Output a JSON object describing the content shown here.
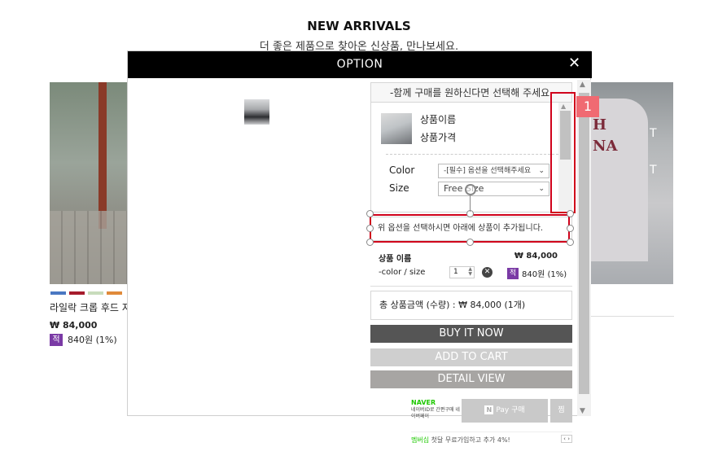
{
  "header": {
    "title": "NEW ARRIVALS",
    "subtitle": "더 좋은 제품으로 찾아온 신상품, 만나보세요."
  },
  "background_product": {
    "name": "라일락 크롭 후드 지",
    "price": "₩ 84,000",
    "mileage_badge": "적",
    "mileage": "840원 (1%)",
    "swatch_colors": [
      "#4a78c2",
      "#a61c2c",
      "#c8dcbc",
      "#e08a3a"
    ],
    "right_print": "H\nNA",
    "right_letters": [
      "T",
      "T"
    ]
  },
  "modal": {
    "title": "OPTION",
    "close_label": "✕"
  },
  "option_panel": {
    "select_header": "-함께 구매를 원하신다면 선택해 주세요.",
    "product_name": "상품이름",
    "product_price": "상품가격",
    "color_label": "Color",
    "color_value": "-[필수] 옵션을 선택해주세요",
    "size_label": "Size",
    "size_value": "Free Size",
    "notice": "위 옵션을 선택하시면 아래에 상품이 추가됩니다.",
    "selected_item": {
      "name": "상품 이름",
      "price": "₩ 84,000",
      "option": "-color / size",
      "quantity": "1",
      "mileage_badge": "적",
      "mileage": "840원 (1%)"
    },
    "total": "총 상품금액 (수량) : ₩ 84,000 (1개)",
    "buy_now": "BUY IT NOW",
    "add_to_cart": "ADD TO CART",
    "detail_view": "DETAIL VIEW",
    "naver_logo": "NAVER",
    "naver_sub": "네이버ID로 간편구매 네이버페이",
    "npay_label": "Pay 구매",
    "npay_badge": "N",
    "zzim": "찜",
    "membership_green": "멤버십",
    "membership_text": "첫달 무료가입하고 추가 4%!",
    "membership_nav": "‹ ›"
  },
  "annotation": {
    "badge": "1",
    "color": "#d0021b"
  }
}
